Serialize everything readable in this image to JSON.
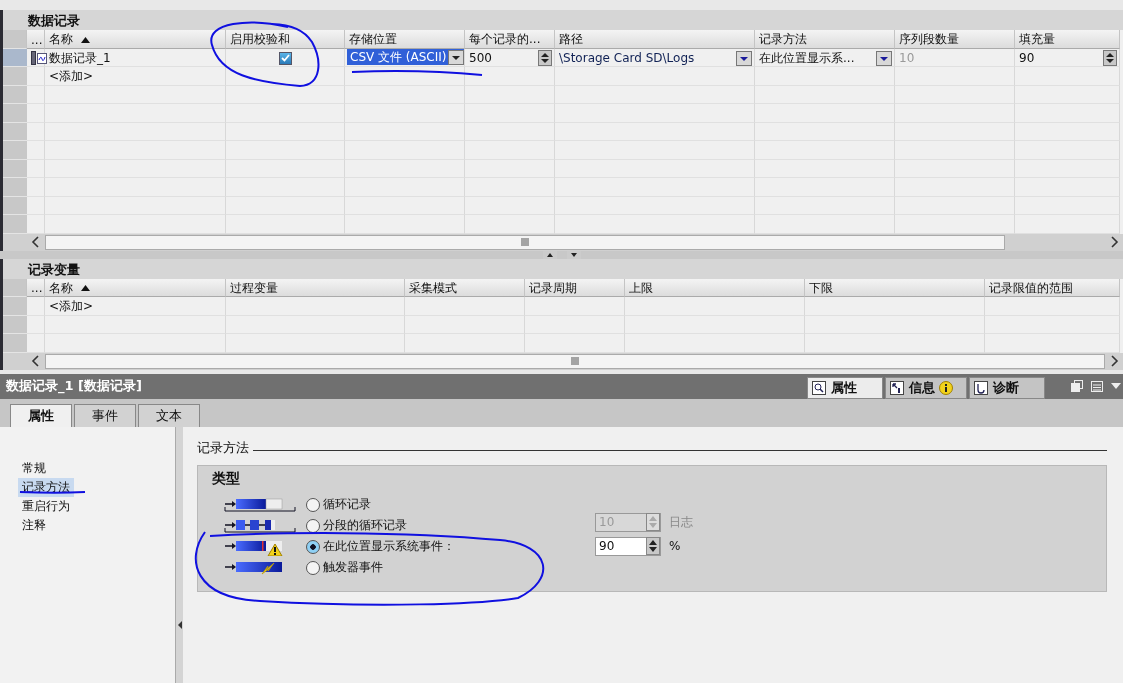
{
  "data_logs": {
    "title": "数据记录",
    "selector_header": "...",
    "columns": [
      "名称",
      "启用校验和",
      "存储位置",
      "每个记录的...",
      "路径",
      "记录方法",
      "序列段数量",
      "填充量"
    ],
    "rows": [
      {
        "name": "数据记录_1",
        "checksum": true,
        "storage": "CSV 文件 (ASCII)",
        "records": "500",
        "path": "\\Storage Card SD\\Logs",
        "method": "在此位置显示系...",
        "segments": "10",
        "segments_disabled": true,
        "fill": "90"
      }
    ],
    "add_row": "<添加>"
  },
  "log_tags": {
    "title": "记录变量",
    "selector_header": "...",
    "columns": [
      "名称",
      "过程变量",
      "采集模式",
      "记录周期",
      "上限",
      "下限",
      "记录限值的范围"
    ],
    "add_row": "<添加>"
  },
  "inspector": {
    "title": "数据记录_1 [数据记录]",
    "views": [
      {
        "label": "属性",
        "selected": true,
        "kind": "properties"
      },
      {
        "label": "信息",
        "selected": false,
        "kind": "info"
      },
      {
        "label": "诊断",
        "selected": false,
        "kind": "diagnostics"
      }
    ],
    "tabs": [
      {
        "label": "属性",
        "selected": true
      },
      {
        "label": "事件",
        "selected": false
      },
      {
        "label": "文本",
        "selected": false
      }
    ],
    "nav": [
      {
        "label": "常规",
        "selected": false
      },
      {
        "label": "记录方法",
        "selected": true
      },
      {
        "label": "重启行为",
        "selected": false
      },
      {
        "label": "注释",
        "selected": false
      }
    ],
    "section": "记录方法",
    "group": "类型",
    "options": [
      {
        "label": "循环记录",
        "selected": false,
        "kind": "circular"
      },
      {
        "label": "分段的循环记录",
        "selected": false,
        "kind": "segmented"
      },
      {
        "label": "在此位置显示系统事件：",
        "selected": true,
        "kind": "event"
      },
      {
        "label": "触发器事件",
        "selected": false,
        "kind": "trigger"
      }
    ],
    "segments_field": {
      "value": "10",
      "unit": "日志",
      "disabled": true
    },
    "fill_field": {
      "value": "90",
      "unit": "%",
      "disabled": false
    }
  }
}
